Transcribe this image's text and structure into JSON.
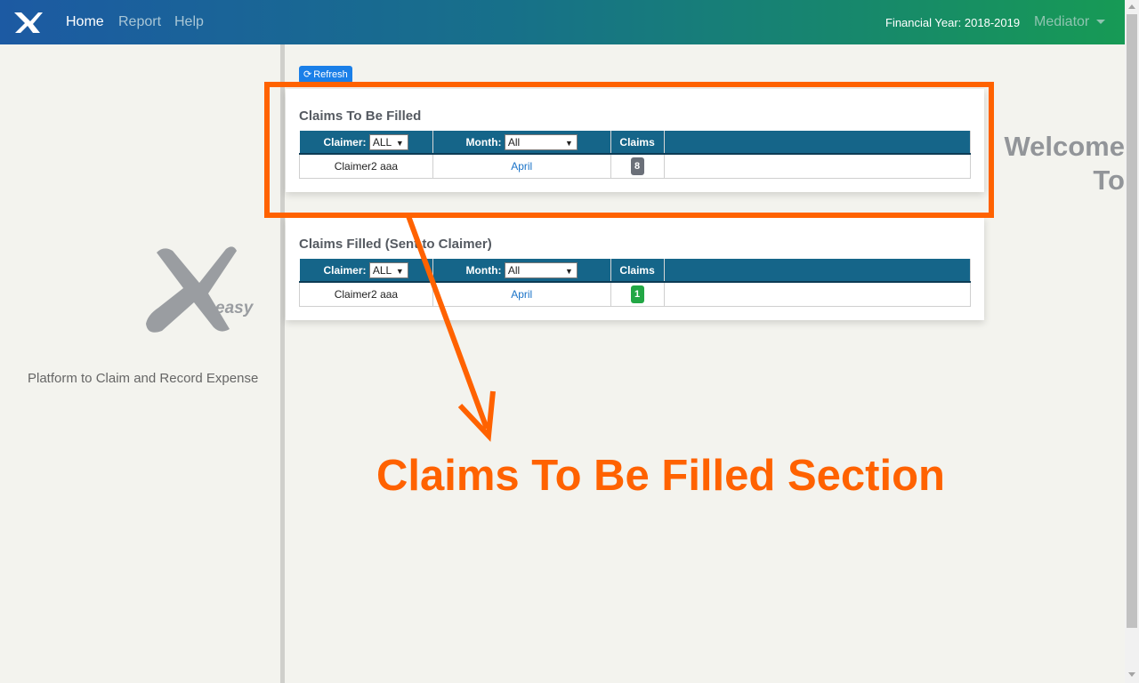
{
  "navbar": {
    "logo_icon": "x-easy-logo-icon",
    "links": [
      {
        "label": "Home",
        "active": true
      },
      {
        "label": "Report",
        "active": false
      },
      {
        "label": "Help",
        "active": false
      }
    ],
    "financial_year": "Financial Year: 2018-2019",
    "user_menu": "Mediator"
  },
  "left_panel": {
    "welcome_line1": "Welcome",
    "welcome_line2": "To",
    "logo_text": "easy",
    "tagline": "Platform to Claim and Record Expense"
  },
  "toolbar": {
    "refresh_label": "Refresh",
    "refresh_icon": "refresh-icon"
  },
  "sections": [
    {
      "title": "Claims To Be Filled",
      "claimer_label": "Claimer:",
      "claimer_value": "ALL",
      "month_label": "Month:",
      "month_value": "All",
      "claims_label": "Claims",
      "rows": [
        {
          "claimer": "Claimer2 aaa",
          "month": "April",
          "claims": "8"
        }
      ]
    },
    {
      "title": "Claims Filled (Sent to Claimer)",
      "claimer_label": "Claimer:",
      "claimer_value": "ALL",
      "month_label": "Month:",
      "month_value": "All",
      "claims_label": "Claims",
      "rows": [
        {
          "claimer": "Claimer2 aaa",
          "month": "April",
          "claims": "1"
        }
      ]
    }
  ],
  "annotation": {
    "text": "Claims To Be Filled Section",
    "color": "#ff6200"
  },
  "colors": {
    "table_header": "#156589",
    "badge_pending": "#6b7079",
    "badge_sent": "#22a745",
    "link": "#1a73c8"
  }
}
